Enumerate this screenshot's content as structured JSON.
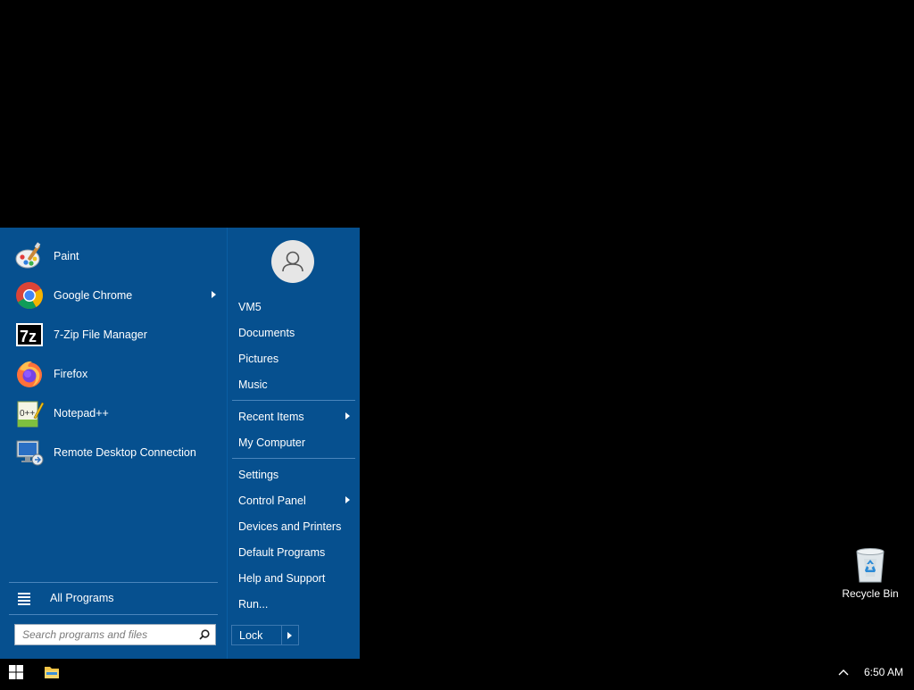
{
  "start_menu": {
    "pinned_apps": [
      {
        "label": "Paint",
        "icon": "paint-icon",
        "has_submenu": false
      },
      {
        "label": "Google Chrome",
        "icon": "chrome-icon",
        "has_submenu": true
      },
      {
        "label": "7-Zip File Manager",
        "icon": "7zip-icon",
        "has_submenu": false
      },
      {
        "label": "Firefox",
        "icon": "firefox-icon",
        "has_submenu": false
      },
      {
        "label": "Notepad++",
        "icon": "notepadpp-icon",
        "has_submenu": false
      },
      {
        "label": "Remote Desktop Connection",
        "icon": "remote-desktop-icon",
        "has_submenu": false
      }
    ],
    "all_programs_label": "All Programs",
    "search": {
      "placeholder": "Search programs and files",
      "value": ""
    },
    "right_items": {
      "vm5": "VM5",
      "documents": "Documents",
      "pictures": "Pictures",
      "music": "Music",
      "recent_items": "Recent Items",
      "my_computer": "My Computer",
      "settings": "Settings",
      "control_panel": "Control Panel",
      "devices_printers": "Devices and Printers",
      "default_programs": "Default Programs",
      "help_support": "Help and Support",
      "run": "Run..."
    },
    "lock_label": "Lock"
  },
  "desktop": {
    "recycle_bin_label": "Recycle Bin"
  },
  "taskbar": {
    "clock": "6:50 AM"
  },
  "colors": {
    "menu_bg": "#06508f",
    "separator": "#4a85bc",
    "desktop_bg": "#000000"
  }
}
